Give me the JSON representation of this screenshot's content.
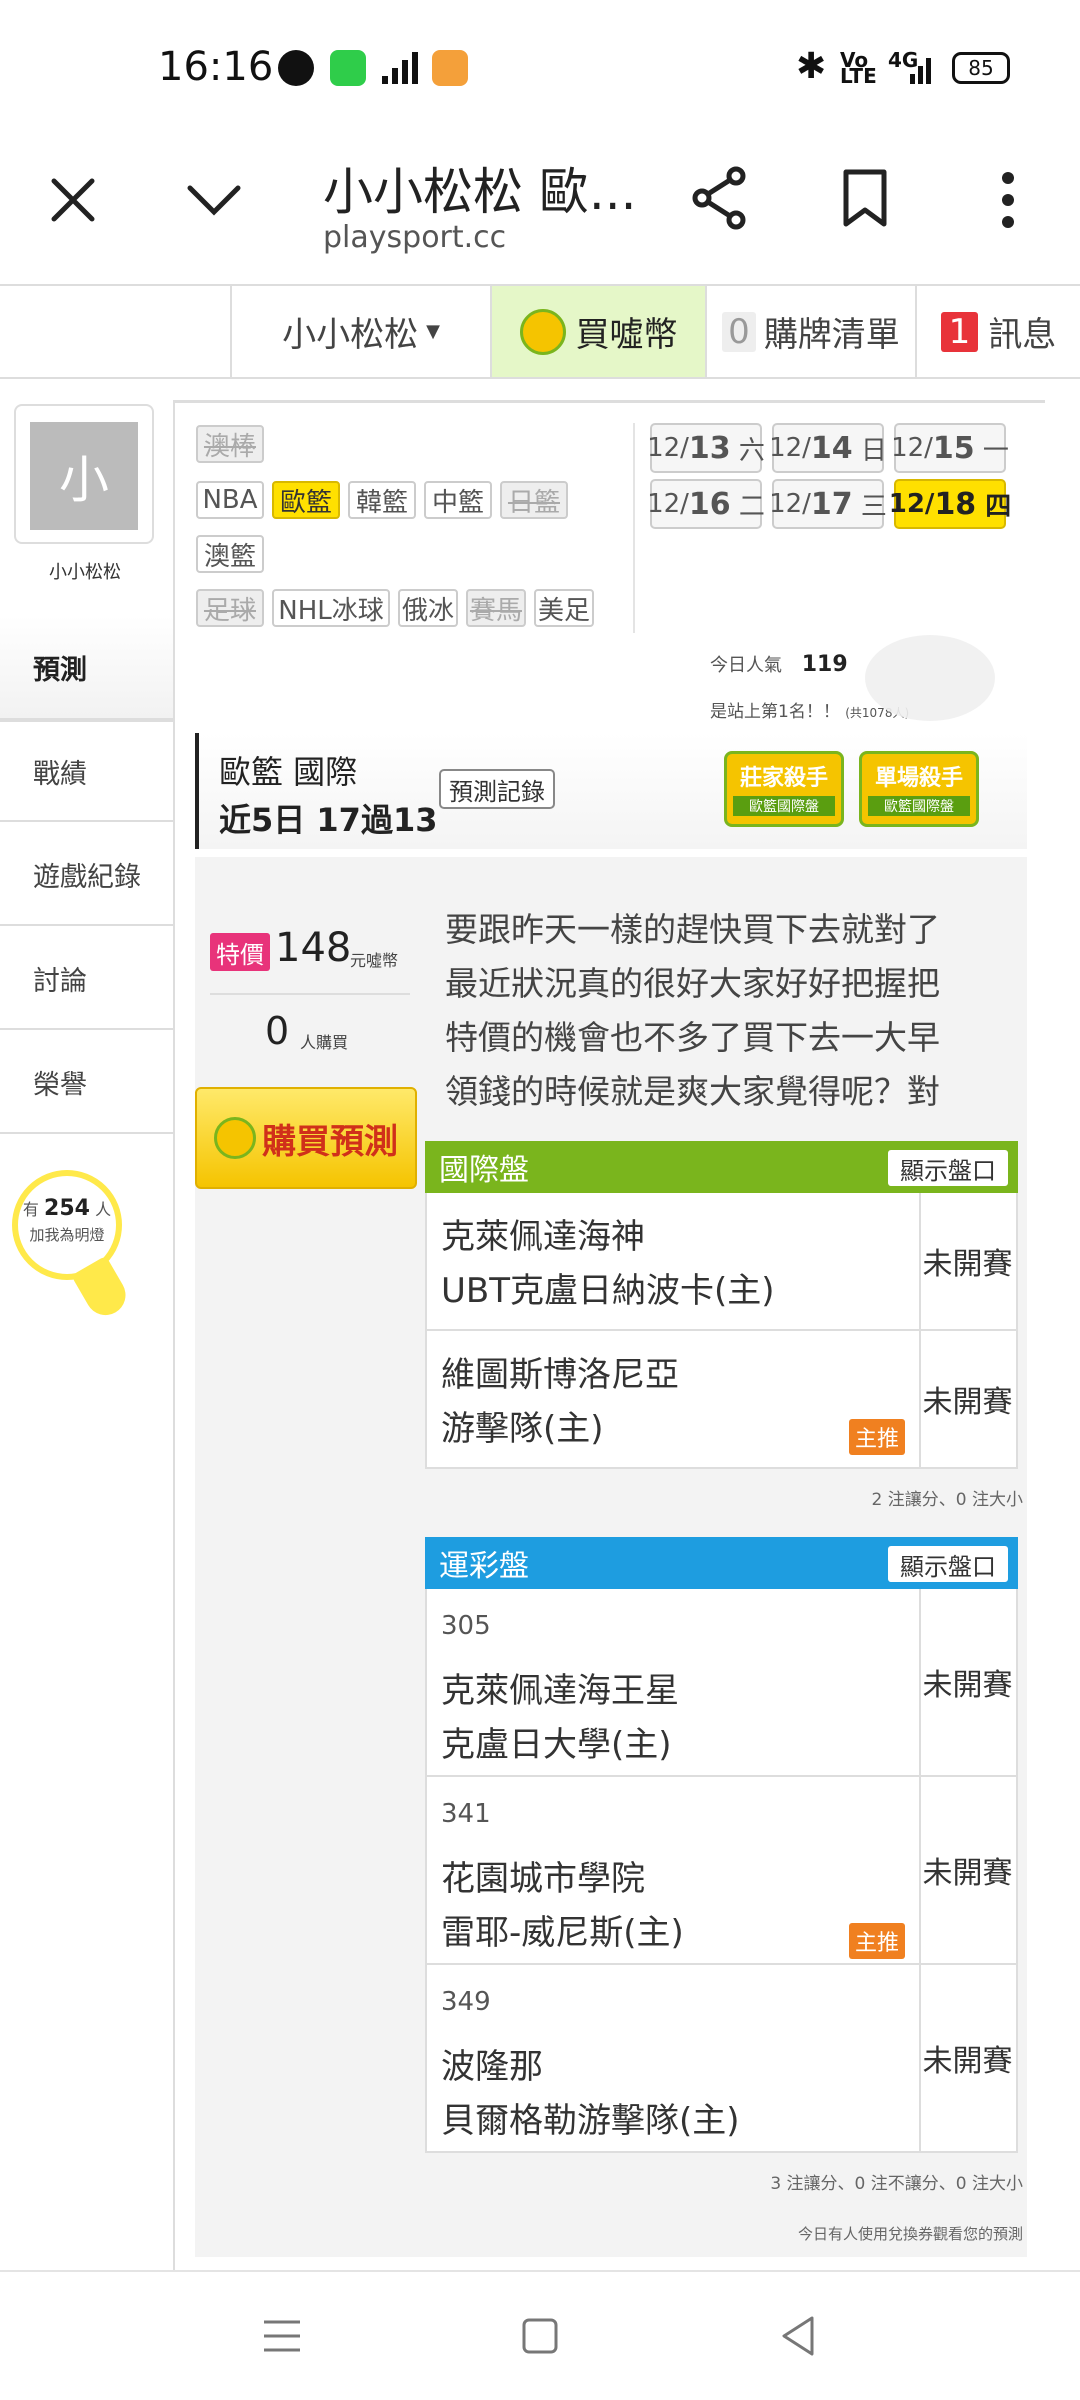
{
  "status_bar": {
    "time": "16:16",
    "battery": "85",
    "network": "4G"
  },
  "browser": {
    "title": "小小松松 歐...",
    "url": "playsport.cc"
  },
  "top_nav": {
    "user_label": "小小松松",
    "buy_coins": "買噓幣",
    "cart_count": "0",
    "cart_label": "購牌清單",
    "msg_count": "1",
    "msg_label": "訊息"
  },
  "profile": {
    "avatar_char": "小",
    "name": "小小松松"
  },
  "sidebar": {
    "items": [
      {
        "label": "預測"
      },
      {
        "label": "戰績"
      },
      {
        "label": "遊戲紀錄"
      },
      {
        "label": "討論"
      },
      {
        "label": "榮譽"
      }
    ],
    "lamp": {
      "prefix": "有",
      "count": "254",
      "suffix": "人",
      "text": "加我為明燈"
    }
  },
  "sports": {
    "row1": [
      "澳棒"
    ],
    "row2": [
      "NBA",
      "歐籃",
      "韓籃",
      "中籃",
      "日籃"
    ],
    "row3": [
      "澳籃"
    ],
    "row4": [
      "足球",
      "NHL冰球",
      "俄冰",
      "賽馬",
      "美足"
    ]
  },
  "dates": [
    {
      "md": "12/",
      "d": "13",
      "w": "六"
    },
    {
      "md": "12/",
      "d": "14",
      "w": "日"
    },
    {
      "md": "12/",
      "d": "15",
      "w": "一"
    },
    {
      "md": "12/",
      "d": "16",
      "w": "二"
    },
    {
      "md": "12/",
      "d": "17",
      "w": "三"
    },
    {
      "md": "12/",
      "d": "18",
      "w": "四"
    }
  ],
  "popularity": {
    "label": "今日人氣",
    "value": "119",
    "rank": "是站上第1名！！",
    "total": "(共1078人)"
  },
  "header_card": {
    "league": "歐籃 國際",
    "record": "近5日 17過13",
    "record_btn": "預測記錄",
    "badge1_title": "莊家殺手",
    "badge1_sub": "歐籃國際盤",
    "badge2_title": "單場殺手",
    "badge2_sub": "歐籃國際盤"
  },
  "price": {
    "tag": "特價",
    "value": "148",
    "unit": "元噓幣",
    "buyers": "0",
    "buyers_unit": "人購買",
    "buy_btn": "購買預測"
  },
  "message": [
    "要跟昨天一樣的趕快買下去就對了",
    "最近狀況真的很好大家好好把握把",
    "特價的機會也不多了買下去一大早",
    "領錢的時候就是爽大家覺得呢？對"
  ],
  "intl_table": {
    "title": "國際盤",
    "show_btn": "顯示盤口",
    "rows": [
      {
        "team1": "克萊佩達海神",
        "team2": "UBT克盧日納波卡(主)",
        "status": "未開賽"
      },
      {
        "team1": "維圖斯博洛尼亞",
        "team2": "游擊隊(主)",
        "status": "未開賽",
        "badge": "主推"
      }
    ],
    "note": "2 注讓分、0 注大小"
  },
  "lottery_table": {
    "title": "運彩盤",
    "show_btn": "顯示盤口",
    "rows": [
      {
        "no": "305",
        "team1": "克萊佩達海王星",
        "team2": "克盧日大學(主)",
        "status": "未開賽"
      },
      {
        "no": "341",
        "team1": "花園城市學院",
        "team2": "雷耶-威尼斯(主)",
        "status": "未開賽",
        "badge": "主推"
      },
      {
        "no": "349",
        "team1": "波隆那",
        "team2": "貝爾格勒游擊隊(主)",
        "status": "未開賽"
      }
    ],
    "note": "3 注讓分、0 注不讓分、0 注大小"
  },
  "footer_note": "今日有人使用兌換券觀看您的預測",
  "colors": {
    "green": "#7ab51d",
    "blue": "#1e9de0",
    "yellow": "#ffe000",
    "orange": "#f08020",
    "pink": "#e8337a"
  }
}
